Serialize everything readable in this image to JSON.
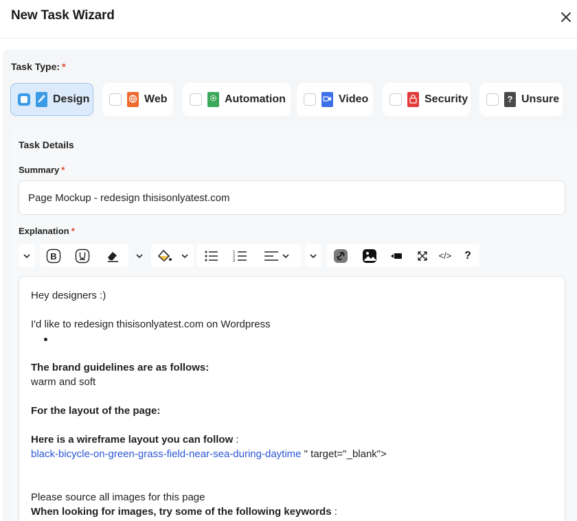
{
  "window": {
    "title": "New Task Wizard",
    "close_icon": "close-icon"
  },
  "task_type": {
    "label": "Task Type:",
    "required_mark": "*",
    "options": [
      {
        "label": "Design",
        "icon": "design-pen-icon",
        "color": "#3b9ae6",
        "selected": true
      },
      {
        "label": "Web",
        "icon": "web-globe-icon",
        "color": "#ef6a2d",
        "selected": false
      },
      {
        "label": "Automation",
        "icon": "automation-gear-icon",
        "color": "#3aa85a",
        "selected": false
      },
      {
        "label": "Video",
        "icon": "video-camera-icon",
        "color": "#3c6fe8",
        "selected": false
      },
      {
        "label": "Security",
        "icon": "security-lock-icon",
        "color": "#e23b3b",
        "selected": false
      },
      {
        "label": "Unsure",
        "icon": "unsure-question-icon",
        "color": "#4a4a4a",
        "selected": false
      }
    ]
  },
  "details": {
    "title": "Task Details",
    "summary_label": "Summary",
    "summary_required": "*",
    "summary_value": "Page Mockup - redesign thisisonlyatest.com",
    "explanation_label": "Explanation",
    "explanation_required": "*"
  },
  "toolbar": {
    "buttons": [
      "paragraph-dropdown",
      "bold",
      "underline",
      "clear-format",
      "more-format-dropdown",
      "fill-color",
      "bullet-list",
      "numbered-list",
      "align",
      "insert-dropdown",
      "link",
      "image",
      "video",
      "fullscreen",
      "code-view",
      "help"
    ],
    "code_label": "</>",
    "help_label": "?"
  },
  "editor": {
    "line1": "Hey designers :)",
    "line2": "I'd like to redesign thisisonlyatest.com on Wordpress",
    "brand_heading": "The brand guidelines are as follows:",
    "brand_text": "warm and soft",
    "layout_heading": "For the  layout of the page:",
    "wireframe_heading": "Here is a wireframe layout you can follow",
    "wireframe_colon": " :",
    "wireframe_link": "black-bicycle-on-green-grass-field-near-sea-during-daytime",
    "wireframe_trailing": " \" target=\"_blank\">",
    "images_line": "Please source all images for this page",
    "keywords_heading": "When looking for images, try some of the following keywords",
    "keywords_colon": " :"
  },
  "colors": {
    "accent": "#3b9ae6",
    "required": "#e0452b",
    "link": "#2a56d4"
  }
}
